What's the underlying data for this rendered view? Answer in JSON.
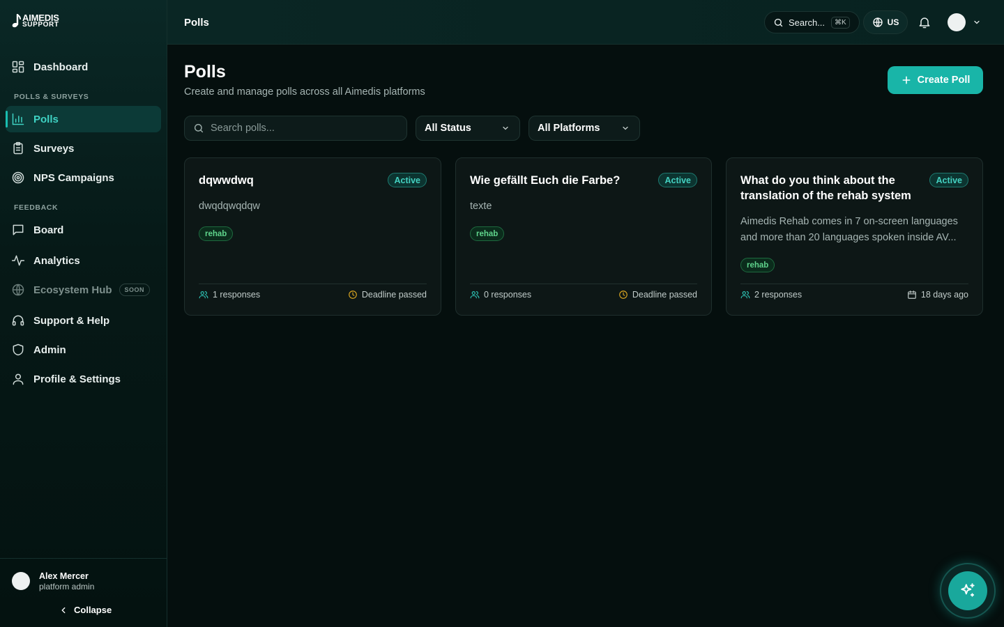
{
  "brand": {
    "line1": "AIMEDIS",
    "line2": "SUPPORT"
  },
  "sidebar": {
    "dashboard": "Dashboard",
    "section_polls": "POLLS & SURVEYS",
    "polls": "Polls",
    "surveys": "Surveys",
    "nps": "NPS Campaigns",
    "section_feedback": "FEEDBACK",
    "board": "Board",
    "analytics": "Analytics",
    "ecosystem": "Ecosystem Hub",
    "soon": "SOON",
    "support": "Support & Help",
    "admin": "Admin",
    "profile": "Profile & Settings"
  },
  "user": {
    "name": "Alex Mercer",
    "role": "platform admin",
    "collapse": "Collapse"
  },
  "topbar": {
    "title": "Polls",
    "search": "Search...",
    "shortcut": "⌘K",
    "lang": "US"
  },
  "page": {
    "title": "Polls",
    "subtitle": "Create and manage polls across all Aimedis platforms",
    "create": "Create Poll"
  },
  "filters": {
    "search_placeholder": "Search polls...",
    "status": "All Status",
    "platform": "All Platforms"
  },
  "cards": [
    {
      "title": "dqwwdwq",
      "status": "Active",
      "description": "dwqdqwqdqw",
      "tag": "rehab",
      "responses": "1 responses",
      "meta": "Deadline passed"
    },
    {
      "title": "Wie gefällt Euch die Farbe?",
      "status": "Active",
      "description": "texte",
      "tag": "rehab",
      "responses": "0 responses",
      "meta": "Deadline passed"
    },
    {
      "title": "What do you think about the translation of the rehab system",
      "status": "Active",
      "description": "Aimedis Rehab comes in 7 on-screen languages and more than 20 languages spoken inside AV...",
      "tag": "rehab",
      "responses": "2 responses",
      "meta": "18 days ago"
    }
  ]
}
